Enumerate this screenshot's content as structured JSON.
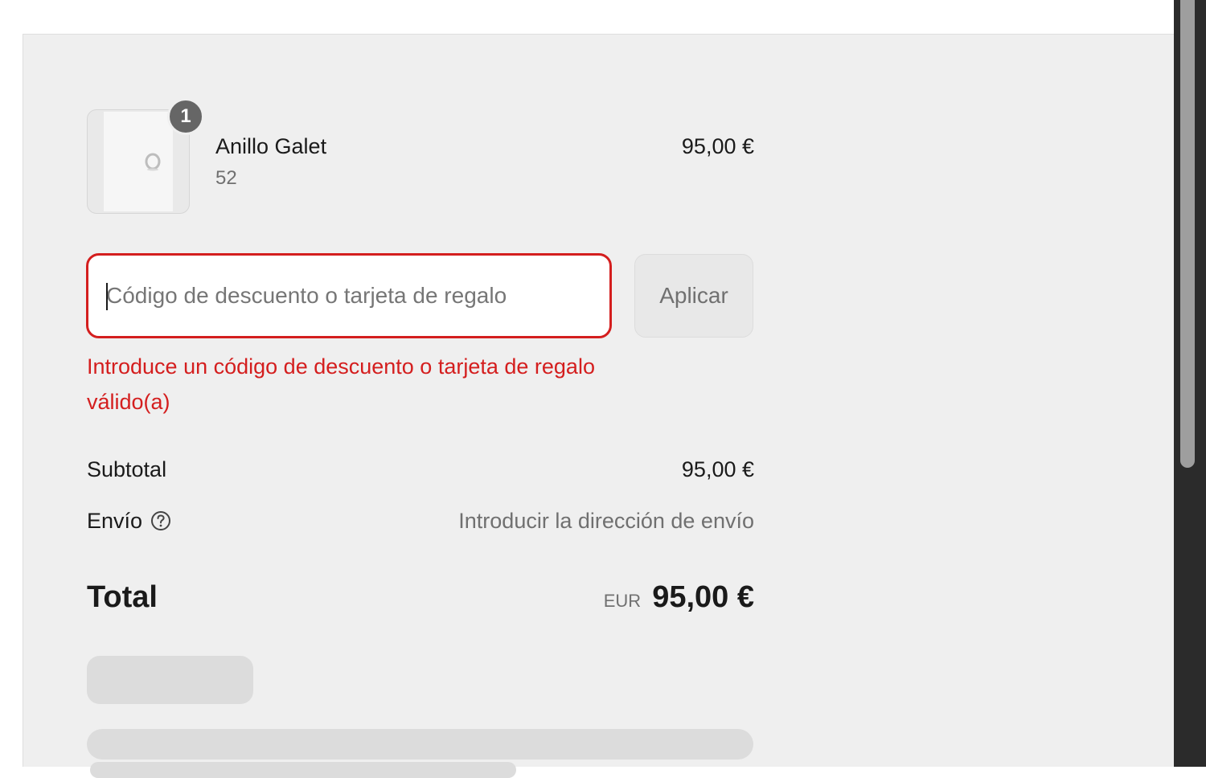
{
  "product": {
    "quantity": "1",
    "name": "Anillo Galet",
    "variant": "52",
    "price": "95,00 €"
  },
  "discount": {
    "placeholder": "Código de descuento o tarjeta de regalo",
    "value": "",
    "apply_label": "Aplicar",
    "error": "Introduce un código de descuento o tarjeta de regalo válido(a)"
  },
  "totals": {
    "subtotal_label": "Subtotal",
    "subtotal_value": "95,00 €",
    "shipping_label": "Envío",
    "shipping_value": "Introducir la dirección de envío",
    "total_label": "Total",
    "currency": "EUR",
    "total_value": "95,00 €"
  },
  "icons": {
    "shipping_help": "question-circle-icon",
    "product_image": "ring-icon"
  },
  "colors": {
    "error": "#d41e1e",
    "panel_background": "#efefef",
    "badge": "#666666"
  }
}
